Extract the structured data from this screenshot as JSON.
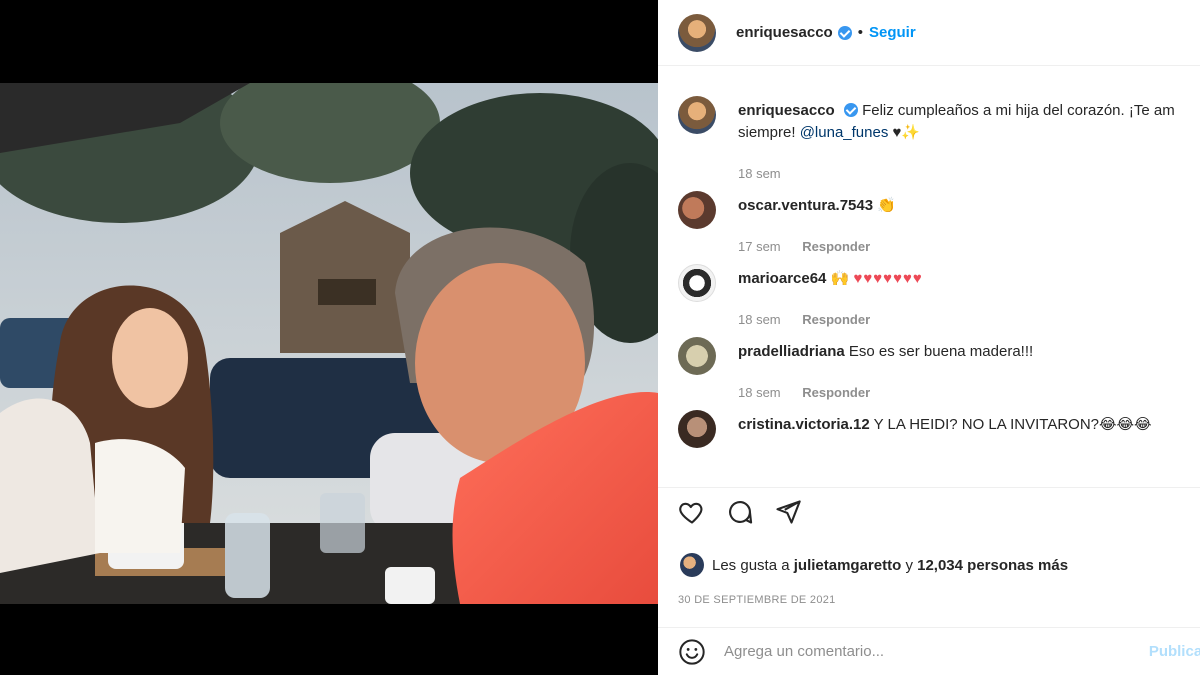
{
  "post": {
    "author": "enriquesacco",
    "follow_label": "Seguir",
    "separator": "•",
    "caption": "Feliz cumpleaños a mi hija del corazón. ¡Te amo para siempre!",
    "caption_line1": "Feliz cumpleaños a mi hija del corazón. ¡Te am",
    "caption_line2": "siempre!",
    "caption_mention": "@luna_funes",
    "caption_emoji": "♥✨",
    "caption_time": "18 sem"
  },
  "comments": [
    {
      "user": "oscar.ventura.7543",
      "text": "👏",
      "time": "17 sem",
      "reply": "Responder"
    },
    {
      "user": "marioarce64",
      "text": "🙌",
      "hearts": "♥♥♥♥♥♥♥",
      "time": "18 sem",
      "reply": "Responder"
    },
    {
      "user": "pradelliadriana",
      "text": "Eso es ser buena madera!!!",
      "time": "18 sem",
      "reply": "Responder"
    },
    {
      "user": "cristina.victoria.12",
      "text": "Y LA HEIDI? NO LA INVITARON?😂😂😂",
      "time": "",
      "reply": ""
    }
  ],
  "likes": {
    "prefix": "Les gusta a",
    "user": "julietamgaretto",
    "mid": "y",
    "count": "12,034 personas más"
  },
  "date": "30 de septiembre de 2021",
  "add_comment": {
    "placeholder": "Agrega un comentario...",
    "publish": "Publicar"
  },
  "icons": {
    "like": "heart-icon",
    "comment": "comment-icon",
    "share": "share-icon",
    "emoji": "emoji-icon"
  },
  "colors": {
    "accent": "#0095f6",
    "heart": "#ed4956",
    "muted": "#8e8e8e",
    "verified": "#3897f0"
  }
}
